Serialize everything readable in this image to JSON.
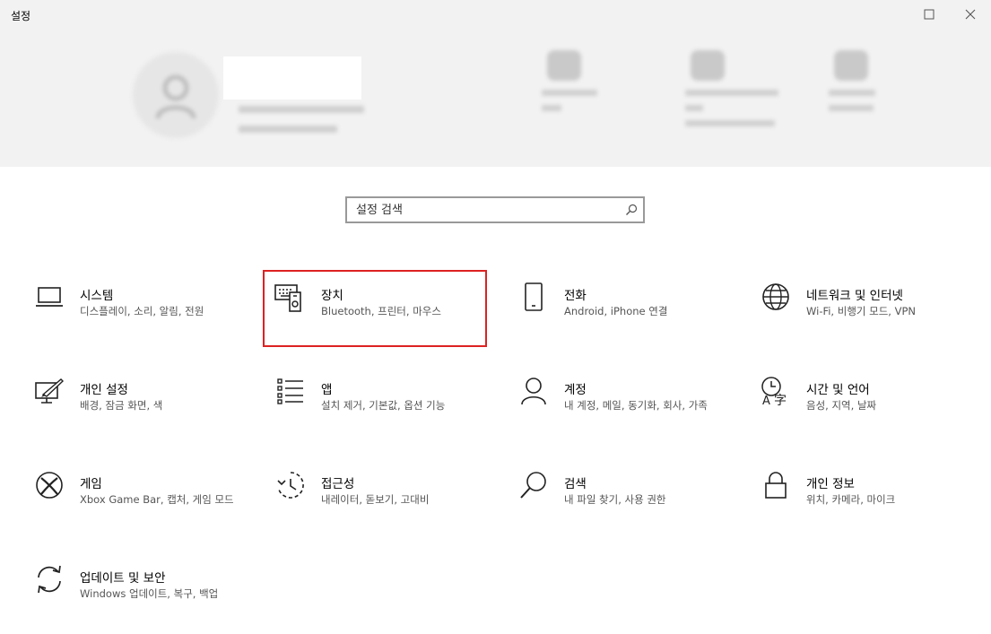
{
  "window": {
    "title": "설정"
  },
  "search": {
    "placeholder": "설정 검색"
  },
  "tiles": [
    {
      "name": "시스템",
      "desc": "디스플레이, 소리, 알림, 전원",
      "icon": "laptop-icon"
    },
    {
      "name": "장치",
      "desc": "Bluetooth, 프린터, 마우스",
      "icon": "devices-icon",
      "selected": true
    },
    {
      "name": "전화",
      "desc": "Android, iPhone 연결",
      "icon": "phone-icon"
    },
    {
      "name": "네트워크 및 인터넷",
      "desc": "Wi-Fi, 비행기 모드, VPN",
      "icon": "globe-icon"
    },
    {
      "name": "개인 설정",
      "desc": "배경, 잠금 화면, 색",
      "icon": "personalization-icon"
    },
    {
      "name": "앱",
      "desc": "설치 제거, 기본값, 옵션 기능",
      "icon": "apps-list-icon"
    },
    {
      "name": "계정",
      "desc": "내 계정, 메일, 동기화, 회사, 가족",
      "icon": "person-icon"
    },
    {
      "name": "시간 및 언어",
      "desc": "음성, 지역, 날짜",
      "icon": "time-language-icon"
    },
    {
      "name": "게임",
      "desc": "Xbox Game Bar, 캡처, 게임 모드",
      "icon": "xbox-icon"
    },
    {
      "name": "접근성",
      "desc": "내레이터, 돋보기, 고대비",
      "icon": "ease-of-access-icon"
    },
    {
      "name": "검색",
      "desc": "내 파일 찾기, 사용 권한",
      "icon": "search-magnifier-icon"
    },
    {
      "name": "개인 정보",
      "desc": "위치, 카메라, 마이크",
      "icon": "lock-icon"
    },
    {
      "name": "업데이트 및 보안",
      "desc": "Windows 업데이트, 복구, 백업",
      "icon": "sync-icon"
    }
  ],
  "colors": {
    "selection_border": "#dd2222",
    "header_band": "#f2f2f2"
  }
}
